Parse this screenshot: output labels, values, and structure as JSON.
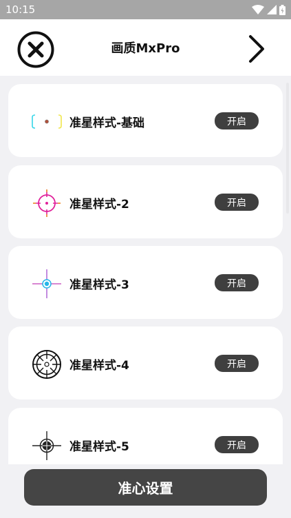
{
  "status_bar": {
    "time": "10:15"
  },
  "header": {
    "title": "画质MxPro"
  },
  "items": [
    {
      "label": "准星样式-基础",
      "button": "开启",
      "icon": "crosshair-basic-icon"
    },
    {
      "label": "准星样式-2",
      "button": "开启",
      "icon": "crosshair-circle-icon"
    },
    {
      "label": "准星样式-3",
      "button": "开启",
      "icon": "crosshair-dot-icon"
    },
    {
      "label": "准星样式-4",
      "button": "开启",
      "icon": "crosshair-scope-icon"
    },
    {
      "label": "准星样式-5",
      "button": "开启",
      "icon": "crosshair-target-icon"
    }
  ],
  "footer": {
    "button": "准心设置"
  },
  "colors": {
    "accent_dark": "#454545",
    "background": "#f1f1f4",
    "card": "#ffffff"
  }
}
